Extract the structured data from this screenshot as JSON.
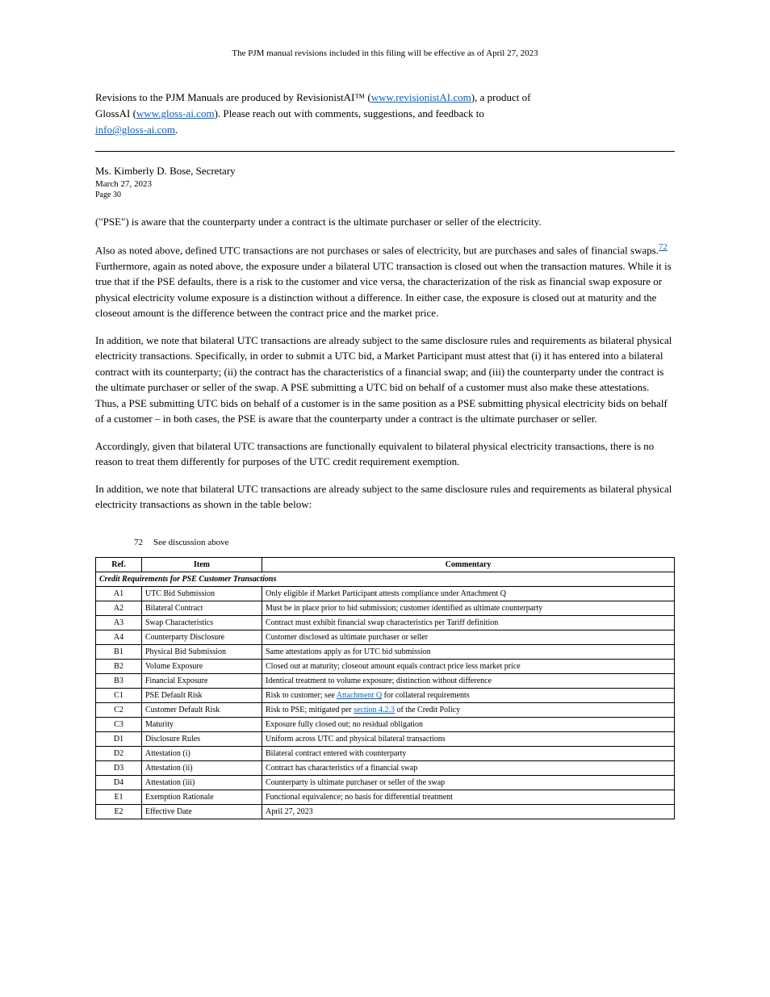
{
  "footer_outer": "The PJM manual revisions included in this filing will be effective as of April 27, 2023",
  "intro": {
    "line1_before": "Revisions to the PJM Manuals are produced by RevisionistAI™ (",
    "line1_link": "www.revisionistAI.com",
    "line1_after": "), a product of",
    "line2_before": "GlossAI (",
    "line2_link": "www.gloss-ai.com",
    "line2_after": ").  Please reach out with comments, suggestions, and feedback to",
    "line3_email": "info@gloss-ai.com",
    "line3_after": "."
  },
  "header": {
    "name": "Ms. Kimberly D. Bose, Secretary",
    "date": "March 27, 2023",
    "page": "Page 30"
  },
  "paragraphs": [
    "(\"PSE\") is aware that the counterparty under a contract is the ultimate purchaser or seller of the electricity.",
    {
      "text_before": "Also as noted above, defined UTC transactions are not purchases or sales of electricity, but are purchases and sales of financial swaps.",
      "fn": "72",
      "text_after": "  Furthermore, again as noted above, the exposure under a bilateral UTC transaction is closed out when the transaction matures. While it is true that if the PSE defaults, there is a risk to the customer and vice versa, the characterization of the risk as financial swap exposure or physical electricity volume exposure is a distinction without a difference. In either case, the exposure is closed out at maturity and the closeout amount is the difference between the contract price and the market price."
    },
    "In addition, we note that bilateral UTC transactions are already subject to the same disclosure rules and requirements as bilateral physical electricity transactions. Specifically, in order to submit a UTC bid, a Market Participant must attest that (i) it has entered into a bilateral contract with its counterparty; (ii) the contract has the characteristics of a financial swap; and (iii) the counterparty under the contract is the ultimate purchaser or seller of the swap. A PSE submitting a UTC bid on behalf of a customer must also make these attestations. Thus, a PSE submitting UTC bids on behalf of a customer is in the same position as a PSE submitting physical electricity bids on behalf of a customer – in both cases, the PSE is aware that the counterparty under a contract is the ultimate purchaser or seller.",
    "Accordingly, given that bilateral UTC transactions are functionally equivalent to bilateral physical electricity transactions, there is no reason to treat them differently for purposes of the UTC credit requirement exemption.",
    "In addition, we note that bilateral UTC transactions are already subject to the same disclosure rules and requirements as bilateral physical electricity transactions as shown in the table below:"
  ],
  "footnotes": [
    {
      "num": "72",
      "text": "See discussion above"
    }
  ],
  "table": {
    "headers": [
      "Ref.",
      "Item",
      "Commentary"
    ],
    "title_row": "Credit Requirements for PSE Customer Transactions",
    "rows": [
      {
        "ref": "A1",
        "item": "UTC Bid Submission",
        "comm": "Only eligible if Market Participant attests compliance under Attachment Q"
      },
      {
        "ref": "A2",
        "item": "Bilateral Contract",
        "comm": "Must be in place prior to bid submission; customer identified as ultimate counterparty"
      },
      {
        "ref": "A3",
        "item": "Swap Characteristics",
        "comm": "Contract must exhibit financial swap characteristics per Tariff definition"
      },
      {
        "ref": "A4",
        "item": "Counterparty Disclosure",
        "comm": "Customer disclosed as ultimate purchaser or seller"
      },
      {
        "ref": "B1",
        "item": "Physical Bid Submission",
        "comm": "Same attestations apply as for UTC bid submission"
      },
      {
        "ref": "B2",
        "item": "Volume Exposure",
        "comm": "Closed out at maturity; closeout amount equals contract price less market price"
      },
      {
        "ref": "B3",
        "item": "Financial Exposure",
        "comm": "Identical treatment to volume exposure; distinction without difference"
      },
      {
        "ref": "C1",
        "item": "PSE Default Risk",
        "comm": {
          "before": "Risk to customer; see ",
          "link": "Attachment Q",
          "after": " for collateral requirements"
        }
      },
      {
        "ref": "C2",
        "item": "Customer Default Risk",
        "comm": {
          "before": "Risk to PSE; mitigated per ",
          "link": "section 4.2.3",
          "after": " of the Credit Policy"
        }
      },
      {
        "ref": "C3",
        "item": "Maturity",
        "comm": "Exposure fully closed out; no residual obligation"
      },
      {
        "ref": "D1",
        "item": "Disclosure Rules",
        "comm": "Uniform across UTC and physical bilateral transactions"
      },
      {
        "ref": "D2",
        "item": "Attestation (i)",
        "comm": "Bilateral contract entered with counterparty"
      },
      {
        "ref": "D3",
        "item": "Attestation (ii)",
        "comm": "Contract has characteristics of a financial swap"
      },
      {
        "ref": "D4",
        "item": "Attestation (iii)",
        "comm": "Counterparty is ultimate purchaser or seller of the swap"
      },
      {
        "ref": "E1",
        "item": "Exemption Rationale",
        "comm": "Functional equivalence; no basis for differential treatment"
      },
      {
        "ref": "E2",
        "item": "Effective Date",
        "comm": "April 27, 2023"
      }
    ]
  }
}
